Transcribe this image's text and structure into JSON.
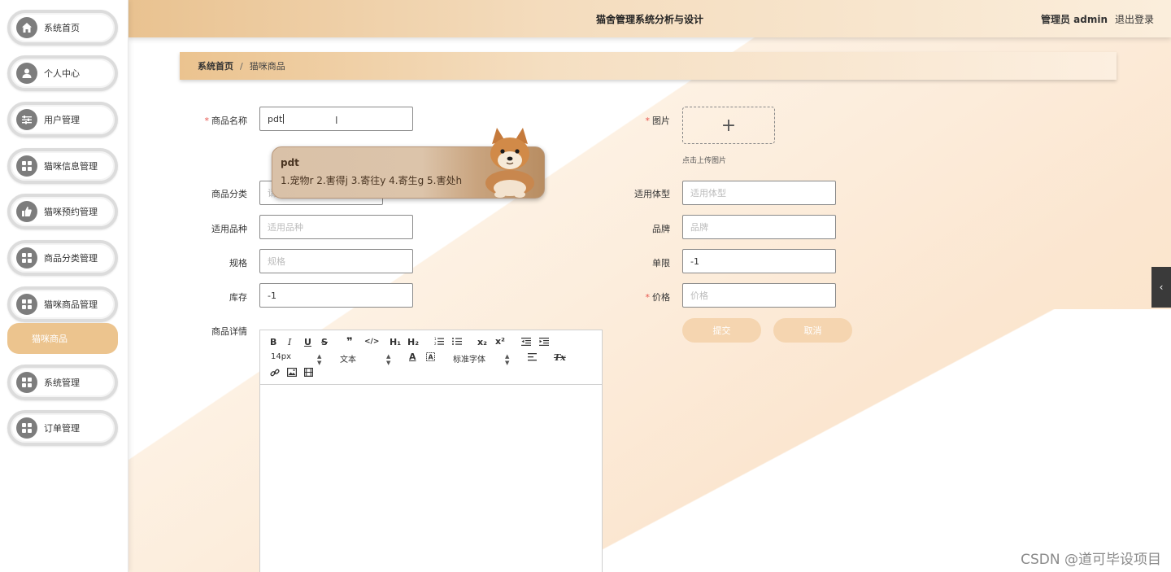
{
  "header": {
    "title": "猫舍管理系统分析与设计",
    "admin": "管理员 admin",
    "logout": "退出登录"
  },
  "sidebar": {
    "items": [
      {
        "label": "系统首页",
        "icon": "home-icon"
      },
      {
        "label": "个人中心",
        "icon": "user-icon"
      },
      {
        "label": "用户管理",
        "icon": "sliders-icon"
      },
      {
        "label": "猫咪信息管理",
        "icon": "grid-icon"
      },
      {
        "label": "猫咪预约管理",
        "icon": "thumb-icon"
      },
      {
        "label": "商品分类管理",
        "icon": "grid-icon"
      },
      {
        "label": "猫咪商品管理",
        "icon": "grid-icon"
      },
      {
        "label": "系统管理",
        "icon": "grid-icon"
      },
      {
        "label": "订单管理",
        "icon": "grid-icon"
      }
    ],
    "sub_item": "猫咪商品"
  },
  "breadcrumb": {
    "home": "系统首页",
    "sep": "/",
    "current": "猫咪商品"
  },
  "form": {
    "name": {
      "label": "商品名称",
      "value": "pdt"
    },
    "category": {
      "label": "商品分类",
      "placeholder": "请"
    },
    "breed": {
      "label": "适用品种",
      "placeholder": "适用品种"
    },
    "spec": {
      "label": "规格",
      "placeholder": "规格"
    },
    "stock": {
      "label": "库存",
      "value": "-1"
    },
    "detail": {
      "label": "商品详情"
    },
    "image": {
      "label": "图片",
      "plus": "+",
      "hint": "点击上传图片"
    },
    "body_type": {
      "label": "适用体型",
      "placeholder": "适用体型"
    },
    "brand": {
      "label": "品牌",
      "placeholder": "品牌"
    },
    "limit": {
      "label": "单限",
      "value": "-1"
    },
    "price": {
      "label": "价格",
      "placeholder": "价格"
    },
    "submit": "提交",
    "cancel": "取消",
    "required_mark": "*"
  },
  "editor": {
    "font_size": "14px",
    "text_style": "文本",
    "font_family": "标准字体",
    "tools": {
      "bold": "B",
      "italic": "I",
      "underline": "U",
      "strike": "S",
      "quote": "❞",
      "code": "</>",
      "h1": "H₁",
      "h2": "H₂",
      "sub": "x₂",
      "sup": "x²",
      "color": "A",
      "clean": "Tx"
    }
  },
  "ime": {
    "composition": "pdt",
    "candidates": "1.宠物r  2.害得j  3.寄往y  4.寄生g  5.害处h"
  },
  "handle": "‹",
  "watermark": "CSDN @道可毕设项目"
}
